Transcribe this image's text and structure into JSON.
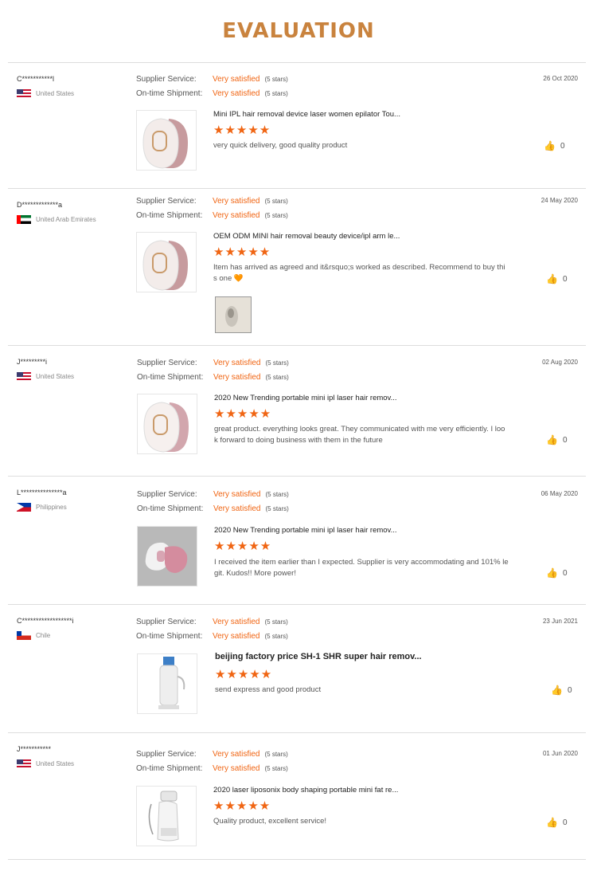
{
  "page_title": "EVALUATION",
  "labels": {
    "supplier": "Supplier Service:",
    "shipment": "On-time Shipment:"
  },
  "stars_glyph": "★★★★★",
  "like_icon": "thumbs-up-icon",
  "colors": {
    "title": "#c9833e",
    "accent": "#f06513"
  },
  "reviews": [
    {
      "user": "C***********l",
      "country": "United States",
      "flag": "us",
      "supplier_value": "Very satisfied",
      "supplier_stars": "(5 stars)",
      "shipment_value": "Very satisfied",
      "shipment_stars": "(5 stars)",
      "date": "26 Oct 2020",
      "product": "Mini IPL hair removal device laser women epilator Tou...",
      "rating": 5,
      "comment": "very quick delivery, good quality product",
      "likes": "0"
    },
    {
      "user": "D*************a",
      "country": "United Arab Emirates",
      "flag": "ae",
      "supplier_value": "Very satisfied",
      "supplier_stars": "(5 stars)",
      "shipment_value": "Very satisfied",
      "shipment_stars": "(5 stars)",
      "date": "24 May 2020",
      "product": "OEM ODM MINI hair removal beauty device/ipl arm le...",
      "rating": 5,
      "comment": "Item has arrived as agreed and it&rsquo;s worked as described. Recommend to buy this one 🧡",
      "likes": "0"
    },
    {
      "user": "J*********i",
      "country": "United States",
      "flag": "us",
      "supplier_value": "Very satisfied",
      "supplier_stars": "(5 stars)",
      "shipment_value": "Very satisfied",
      "shipment_stars": "(5 stars)",
      "date": "02 Aug 2020",
      "product": "2020 New Trending portable mini ipl laser hair remov...",
      "rating": 5,
      "comment": "great product. everything looks great. They communicated with me very efficiently. I look forward to doing business with them in the future",
      "likes": "0"
    },
    {
      "user": "L***************a",
      "country": "Philippines",
      "flag": "ph",
      "supplier_value": "Very satisfied",
      "supplier_stars": "(5 stars)",
      "shipment_value": "Very satisfied",
      "shipment_stars": "(5 stars)",
      "date": "06 May 2020",
      "product": "2020 New Trending portable mini ipl laser hair remov...",
      "rating": 5,
      "comment": "I received the item earlier than I expected. Supplier is very accommodating and 101% legit. Kudos!! More power!",
      "likes": "0"
    },
    {
      "user": "C******************i",
      "country": "Chile",
      "flag": "cl",
      "supplier_value": "Very satisfied",
      "supplier_stars": "(5 stars)",
      "shipment_value": "Very satisfied",
      "shipment_stars": "(5 stars)",
      "date": "23 Jun 2021",
      "product": "beijing factory price SH-1 SHR super hair remov...",
      "rating": 5,
      "comment": "send express and good product",
      "likes": "0"
    },
    {
      "user": "J***********",
      "country": "United States",
      "flag": "us",
      "supplier_value": "Very satisfied",
      "supplier_stars": "(5 stars)",
      "shipment_value": "Very satisfied",
      "shipment_stars": "(5 stars)",
      "date": "01 Jun 2020",
      "product": "2020 laser liposonix body shaping portable mini fat re...",
      "rating": 5,
      "comment": "Quality product, excellent service!",
      "likes": "0"
    }
  ]
}
